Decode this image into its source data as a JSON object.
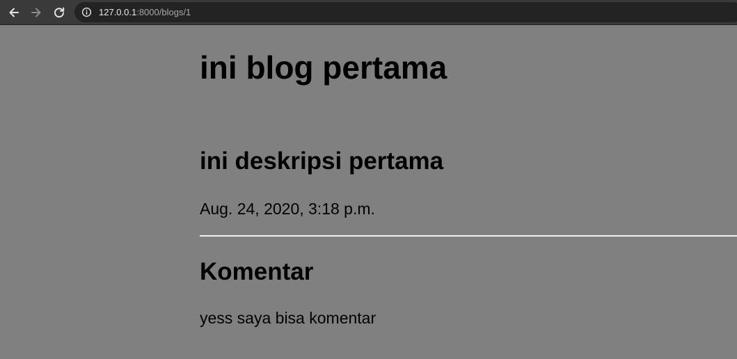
{
  "browser": {
    "url_host": "127.0.0.1",
    "url_path": ":8000/blogs/1",
    "icons": {
      "back": "arrow-left-icon",
      "forward": "arrow-right-icon",
      "reload": "reload-icon",
      "info": "info-icon"
    }
  },
  "blog": {
    "title": "ini blog pertama",
    "description": "ini deskripsi pertama",
    "date": "Aug. 24, 2020, 3:18 p.m."
  },
  "comments": {
    "heading": "Komentar",
    "items": [
      {
        "text": "yess saya bisa komentar"
      }
    ]
  },
  "colors": {
    "page_background": "#808080",
    "toolbar_background": "#3a3a3a",
    "address_background": "#232323",
    "divider": "#f2f2f2"
  }
}
